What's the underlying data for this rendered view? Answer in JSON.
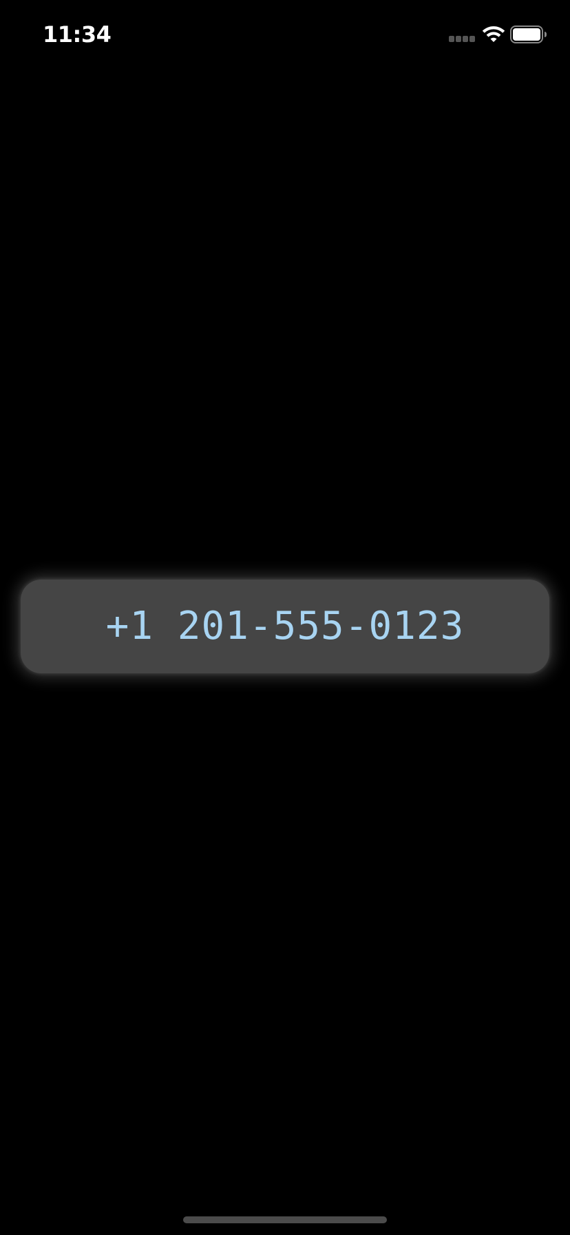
{
  "status_bar": {
    "time": "11:34",
    "signal_icon": "cellular-signal-icon",
    "wifi_icon": "wifi-icon",
    "battery_icon": "battery-icon"
  },
  "card": {
    "phone_number": "+1 201-555-0123",
    "text_color": "#a8d4f2",
    "background_color": "#454545"
  },
  "home_indicator": {
    "icon": "home-indicator"
  }
}
